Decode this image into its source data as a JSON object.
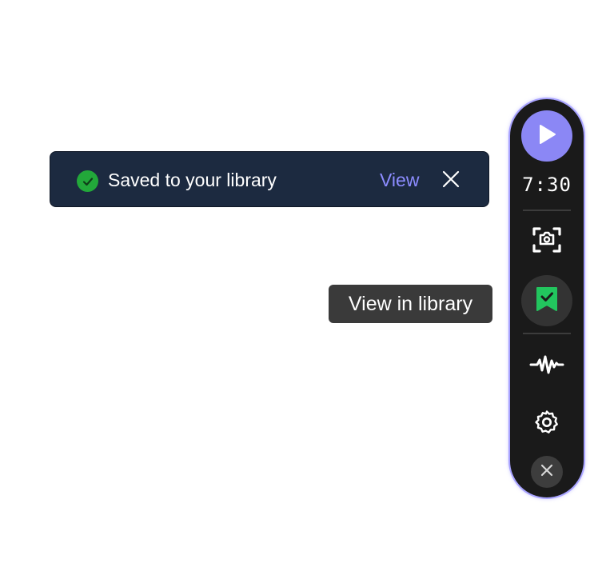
{
  "toast": {
    "message": "Saved to your library",
    "action_label": "View",
    "colors": {
      "background": "#1c2a40",
      "success": "#22a83a",
      "action": "#8c8cff"
    }
  },
  "tooltip": {
    "text": "View in library"
  },
  "toolbar": {
    "timer": "7:30",
    "items": [
      {
        "icon": "play-icon",
        "accent": "#8b87f5"
      },
      {
        "icon": "screenshot-camera-icon"
      },
      {
        "icon": "bookmark-check-icon",
        "accent": "#22c55e"
      },
      {
        "icon": "audio-waveform-icon"
      },
      {
        "icon": "settings-gear-icon"
      },
      {
        "icon": "close-icon"
      }
    ],
    "colors": {
      "background": "#1a1a1a",
      "border": "#a8a3ff"
    }
  }
}
